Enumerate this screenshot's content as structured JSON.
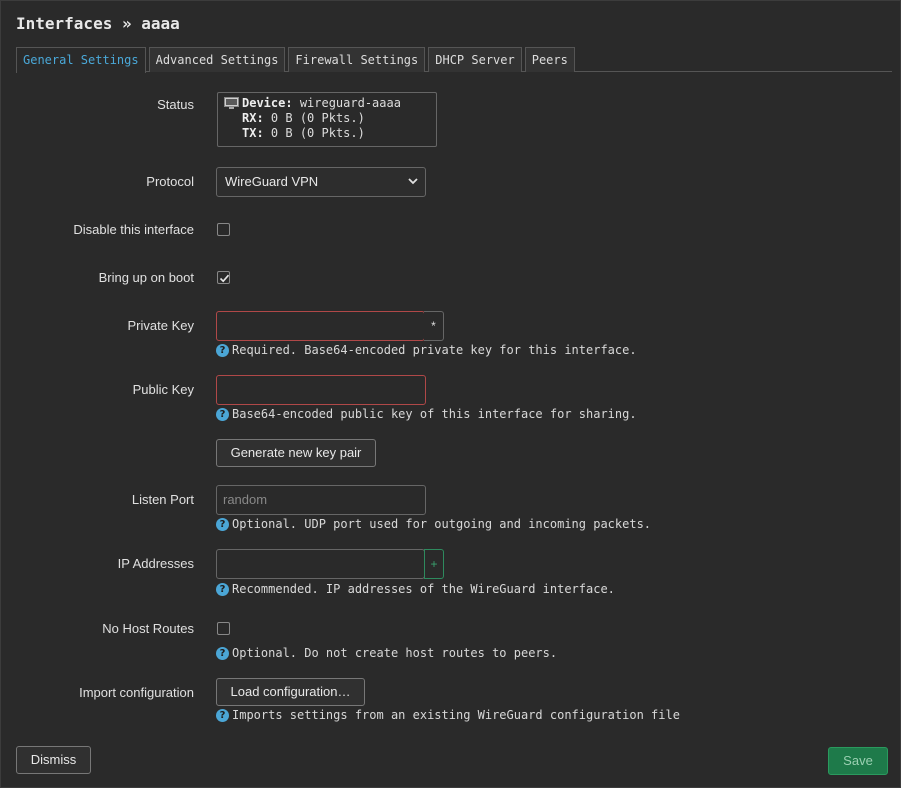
{
  "title": "Interfaces » aaaa",
  "tabs": [
    {
      "label": "General Settings",
      "active": true
    },
    {
      "label": "Advanced Settings",
      "active": false
    },
    {
      "label": "Firewall Settings",
      "active": false
    },
    {
      "label": "DHCP Server",
      "active": false
    },
    {
      "label": "Peers",
      "active": false
    }
  ],
  "status": {
    "label": "Status",
    "device_key": "Device:",
    "device_val": "wireguard-aaaa",
    "rx_key": "RX:",
    "rx_val": "0 B (0 Pkts.)",
    "tx_key": "TX:",
    "tx_val": "0 B (0 Pkts.)"
  },
  "protocol": {
    "label": "Protocol",
    "value": "WireGuard VPN"
  },
  "disable": {
    "label": "Disable this interface",
    "checked": false
  },
  "boot": {
    "label": "Bring up on boot",
    "checked": true
  },
  "private_key": {
    "label": "Private Key",
    "value": "",
    "addon": "*",
    "hint": "Required. Base64-encoded private key for this interface."
  },
  "public_key": {
    "label": "Public Key",
    "value": "",
    "hint": "Base64-encoded public key of this interface for sharing."
  },
  "generate_button": "Generate new key pair",
  "listen_port": {
    "label": "Listen Port",
    "placeholder": "random",
    "hint": "Optional. UDP port used for outgoing and incoming packets."
  },
  "ip_addresses": {
    "label": "IP Addresses",
    "value": "",
    "addon": "+",
    "hint": "Recommended. IP addresses of the WireGuard interface."
  },
  "no_host_routes": {
    "label": "No Host Routes",
    "checked": false,
    "hint": "Optional. Do not create host routes to peers."
  },
  "import_config": {
    "label": "Import configuration",
    "button": "Load configuration…",
    "hint": "Imports settings from an existing WireGuard configuration file"
  },
  "footer": {
    "dismiss": "Dismiss",
    "save": "Save"
  },
  "colors": {
    "accent": "#4aa8d8",
    "invalid_border": "#b04848",
    "save_bg": "#1e7a4a",
    "help_icon": "#4ba6d6"
  }
}
